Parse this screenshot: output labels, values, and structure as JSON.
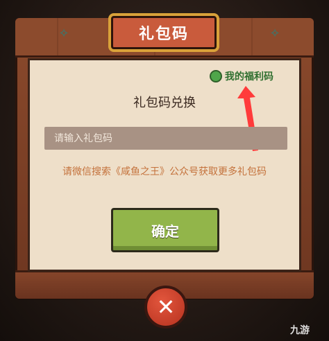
{
  "dialog": {
    "title": "礼包码",
    "section_title": "礼包码兑换",
    "welfare_link": "我的福利码",
    "input_placeholder": "请输入礼包码",
    "hint": "请微信搜索《咸鱼之王》公众号获取更多礼包码",
    "confirm_label": "确定",
    "close_icon": "✕"
  },
  "watermark": "九游",
  "colors": {
    "panel": "#eedfc9",
    "frame": "#8b4a2c",
    "confirm": "#92b54a",
    "close": "#d9462f",
    "hint": "#c4723c",
    "arrow": "#ff3b3b"
  },
  "icons": [
    "fish-icon-left",
    "fish-icon-right",
    "welfare-icon",
    "red-arrow-annotation",
    "close-icon"
  ]
}
